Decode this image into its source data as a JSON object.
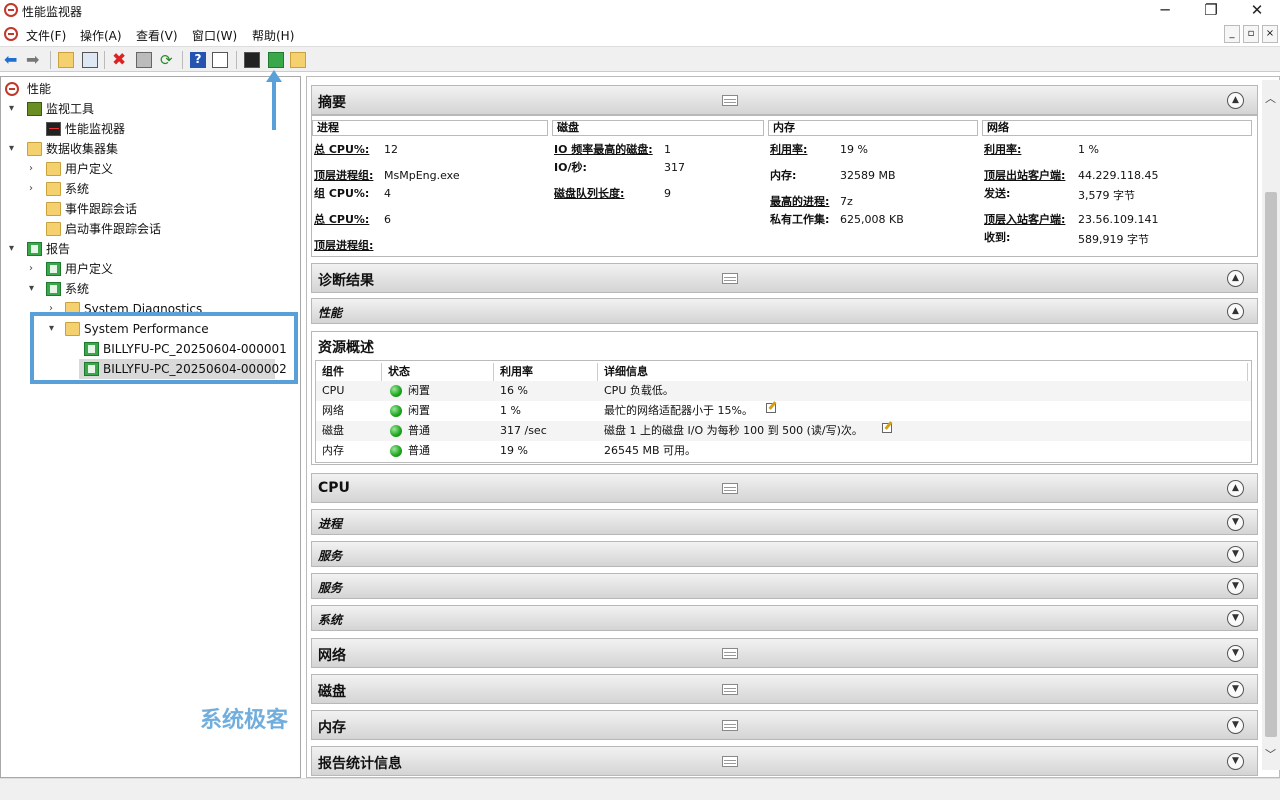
{
  "window": {
    "title": "性能监视器"
  },
  "menu": [
    "文件(F)",
    "操作(A)",
    "查看(V)",
    "窗口(W)",
    "帮助(H)"
  ],
  "tree": {
    "root": "性能",
    "monitor_tools": "监视工具",
    "perf_monitor": "性能监视器",
    "dcs": "数据收集器集",
    "dcs_user": "用户定义",
    "dcs_system": "系统",
    "dcs_trace": "事件跟踪会话",
    "dcs_startup": "启动事件跟踪会话",
    "reports": "报告",
    "rep_user": "用户定义",
    "rep_system": "系统",
    "sys_diag": "System Diagnostics",
    "sys_perf": "System Performance",
    "report1": "BILLYFU-PC_20250604-000001",
    "report2": "BILLYFU-PC_20250604-000002"
  },
  "summary": {
    "title": "摘要",
    "process": {
      "head": "进程",
      "l1": "总 CPU%:",
      "v1": "12",
      "l2": "顶层进程组:",
      "v2": "MsMpEng.exe",
      "l3": "组 CPU%:",
      "v3": "4",
      "l4": "总 CPU%:",
      "v4": "6",
      "l5": "顶层进程组:"
    },
    "disk": {
      "head": "磁盘",
      "l1": "IO 频率最高的磁盘:",
      "v1": "1",
      "l2": "IO/秒:",
      "v2": "317",
      "l3": "磁盘队列长度:",
      "v3": "9"
    },
    "memory": {
      "head": "内存",
      "l1": "利用率:",
      "v1": "19 %",
      "l2": "内存:",
      "v2": "32589 MB",
      "l3": "最高的进程:",
      "v3": "7z",
      "l4": "私有工作集:",
      "v4": "625,008 KB"
    },
    "network": {
      "head": "网络",
      "l1": "利用率:",
      "v1": "1 %",
      "l2": "顶层出站客户端:",
      "v2": "44.229.118.45",
      "l3": "发送:",
      "v3": "3,579 字节",
      "l4": "顶层入站客户端:",
      "v4": "23.56.109.141",
      "l5": "收到:",
      "v5": "589,919 字节"
    }
  },
  "diag": {
    "title": "诊断结果",
    "perf": "性能"
  },
  "resource": {
    "title": "资源概述",
    "headers": [
      "组件",
      "状态",
      "利用率",
      "详细信息"
    ],
    "rows": [
      {
        "comp": "CPU",
        "status": "闲置",
        "util": "16 %",
        "detail": "CPU 负载低。"
      },
      {
        "comp": "网络",
        "status": "闲置",
        "util": "1 %",
        "detail": "最忙的网络适配器小于 15%。"
      },
      {
        "comp": "磁盘",
        "status": "普通",
        "util": "317 /sec",
        "detail": "磁盘 1 上的磁盘 I/O 为每秒 100 到 500 (读/写)次。"
      },
      {
        "comp": "内存",
        "status": "普通",
        "util": "19 %",
        "detail": "26545 MB 可用。"
      }
    ]
  },
  "sections": {
    "cpu": "CPU",
    "proc": "进程",
    "svc1": "服务",
    "svc2": "服务",
    "sys": "系统",
    "net": "网络",
    "disk": "磁盘",
    "mem": "内存",
    "stats": "报告统计信息"
  },
  "watermark": "系统极客"
}
